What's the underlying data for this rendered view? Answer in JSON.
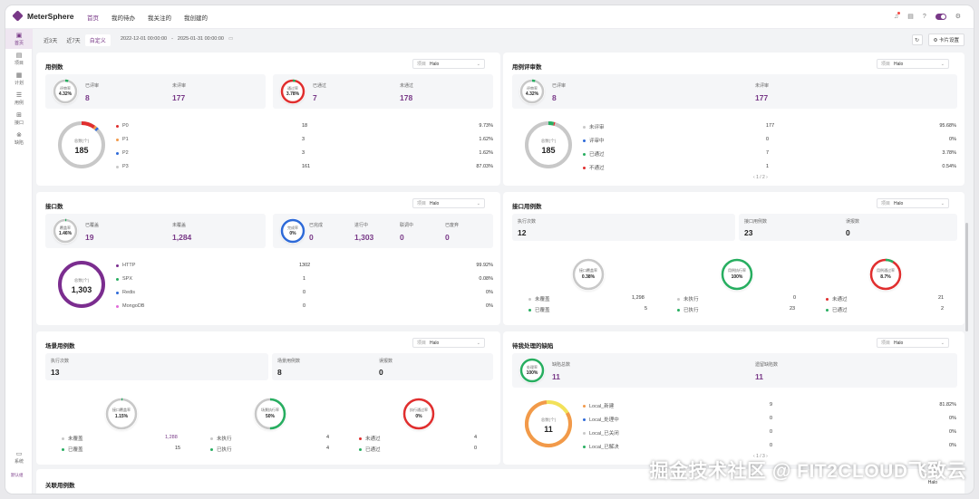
{
  "app": {
    "name": "MeterSphere"
  },
  "top_nav": [
    "首页",
    "我的待办",
    "我关注的",
    "我创建的"
  ],
  "sidebar": {
    "items": [
      {
        "label": "首页",
        "icon": "home-icon",
        "glyph": "▣"
      },
      {
        "label": "项目",
        "icon": "project-icon",
        "glyph": "▤"
      },
      {
        "label": "计划",
        "icon": "plan-icon",
        "glyph": "▦"
      },
      {
        "label": "用例",
        "icon": "case-icon",
        "glyph": "☰"
      },
      {
        "label": "接口",
        "icon": "api-icon",
        "glyph": "⊞"
      },
      {
        "label": "缺陷",
        "icon": "bug-icon",
        "glyph": "⊗"
      }
    ],
    "bottom": {
      "label": "系统",
      "glyph": "▭"
    },
    "org": "默认组"
  },
  "filter": {
    "options": [
      "近3天",
      "近7天",
      "自定义"
    ],
    "selected": "自定义",
    "start": "2022-12-01 00:00:00",
    "separator": "-",
    "end": "2025-01-31 00:00:00",
    "card_settings": "卡片设置"
  },
  "project_select": {
    "label": "项目",
    "value": "Halo"
  },
  "cards": {
    "case_count": {
      "title": "用例数",
      "ring": {
        "title": "评审率",
        "value": "4.32%",
        "color": "#b5b5b5"
      },
      "reviewed": {
        "label": "已评审",
        "value": "8"
      },
      "unreviewed": {
        "label": "未评审",
        "value": "177"
      },
      "ring2": {
        "title": "通过率",
        "value": "3.78%",
        "color": "#e02e2e"
      },
      "passed": {
        "label": "已通过",
        "value": "7"
      },
      "notpassed": {
        "label": "未通过",
        "value": "178"
      },
      "donut": {
        "title": "总数(个)",
        "value": "185"
      },
      "legend": [
        {
          "name": "P0",
          "count": "18",
          "pct": "9.73%",
          "color": "#e02e2e"
        },
        {
          "name": "P1",
          "count": "3",
          "pct": "1.62%",
          "color": "#f2994a"
        },
        {
          "name": "P2",
          "count": "3",
          "pct": "1.62%",
          "color": "#2e6ad8"
        },
        {
          "name": "P3",
          "count": "161",
          "pct": "87.03%",
          "color": "#c8c8c8"
        }
      ]
    },
    "case_review": {
      "title": "用例评审数",
      "ring": {
        "title": "评审率",
        "value": "4.32%"
      },
      "reviewed": {
        "label": "已评审",
        "value": "8"
      },
      "unreviewed": {
        "label": "未评审",
        "value": "177"
      },
      "donut": {
        "title": "总数(个)",
        "value": "185"
      },
      "legend": [
        {
          "name": "未评审",
          "count": "177",
          "pct": "95.68%",
          "color": "#c8c8c8"
        },
        {
          "name": "评审中",
          "count": "0",
          "pct": "0%",
          "color": "#2e6ad8"
        },
        {
          "name": "已通过",
          "count": "7",
          "pct": "3.78%",
          "color": "#27ae60"
        },
        {
          "name": "不通过",
          "count": "1",
          "pct": "0.54%",
          "color": "#e02e2e"
        }
      ],
      "pager": "1 / 2"
    },
    "api_count": {
      "title": "接口数",
      "ring": {
        "title": "覆盖率",
        "value": "1.46%"
      },
      "covered": {
        "label": "已覆盖",
        "value": "19"
      },
      "uncovered": {
        "label": "未覆盖",
        "value": "1,284"
      },
      "ring2": {
        "title": "完成率",
        "value": "0%"
      },
      "stats": [
        {
          "label": "已完成",
          "value": "0"
        },
        {
          "label": "进行中",
          "value": "1,303"
        },
        {
          "label": "联调中",
          "value": "0"
        },
        {
          "label": "已废弃",
          "value": "0"
        }
      ],
      "donut": {
        "title": "总数(个)",
        "value": "1,303"
      },
      "legend": [
        {
          "name": "HTTP",
          "count": "1302",
          "pct": "99.92%",
          "color": "#7b2d8f"
        },
        {
          "name": "SPX",
          "count": "1",
          "pct": "0.08%",
          "color": "#27ae60"
        },
        {
          "name": "Redis",
          "count": "0",
          "pct": "0%",
          "color": "#2e6ad8"
        },
        {
          "name": "MongoDB",
          "count": "0",
          "pct": "0%",
          "color": "#e26bd9"
        }
      ]
    },
    "api_case": {
      "title": "接口用例数",
      "stats": [
        {
          "label": "执行次数",
          "value": "12"
        },
        {
          "label": "接口用例数",
          "value": "23"
        },
        {
          "label": "误报数",
          "value": "0"
        }
      ],
      "rings": [
        {
          "title": "接口覆盖率",
          "value": "0.38%"
        },
        {
          "title": "用例执行率",
          "value": "100%"
        },
        {
          "title": "用例通过率",
          "value": "8.7%"
        }
      ],
      "legends": [
        [
          {
            "name": "未覆盖",
            "v": "1,298"
          },
          {
            "name": "已覆盖",
            "v": "5"
          }
        ],
        [
          {
            "name": "未执行",
            "v": "0"
          },
          {
            "name": "已执行",
            "v": "23"
          }
        ],
        [
          {
            "name": "未通过",
            "v": "21"
          },
          {
            "name": "已通过",
            "v": "2"
          }
        ]
      ]
    },
    "scenario": {
      "title": "场景用例数",
      "stats": [
        {
          "label": "执行次数",
          "value": "13"
        },
        {
          "label": "场景用例数",
          "value": "8"
        },
        {
          "label": "误报数",
          "value": "0"
        }
      ],
      "rings": [
        {
          "title": "接口覆盖率",
          "value": "1.15%"
        },
        {
          "title": "场景执行率",
          "value": "50%"
        },
        {
          "title": "执行通过率",
          "value": "0%"
        }
      ],
      "legends": [
        [
          {
            "name": "未覆盖",
            "v": "1,288"
          },
          {
            "name": "已覆盖",
            "v": "15"
          }
        ],
        [
          {
            "name": "未执行",
            "v": "4"
          },
          {
            "name": "已执行",
            "v": "4"
          }
        ],
        [
          {
            "name": "未通过",
            "v": "4"
          },
          {
            "name": "已通过",
            "v": "0"
          }
        ]
      ]
    },
    "bugs": {
      "title": "待我处理的缺陷",
      "ring": {
        "title": "处理率",
        "value": "100%"
      },
      "total": {
        "label": "缺陷总数",
        "value": "11"
      },
      "legacy": {
        "label": "遗留缺陷数",
        "value": "11"
      },
      "donut": {
        "title": "总数(个)",
        "value": "11"
      },
      "legend": [
        {
          "name": "Local_新建",
          "count": "9",
          "pct": "81.82%",
          "color": "#f2994a"
        },
        {
          "name": "Local_处理中",
          "count": "0",
          "pct": "0%",
          "color": "#2e6ad8"
        },
        {
          "name": "Local_已关闭",
          "count": "0",
          "pct": "0%",
          "color": "#c8c8c8"
        },
        {
          "name": "Local_已解决",
          "count": "0",
          "pct": "0%",
          "color": "#27ae60"
        }
      ],
      "pager": "1 / 3"
    },
    "related": {
      "title": "关联用例数",
      "select_value": "Halo"
    }
  },
  "watermark": "掘金技术社区 @ FIT2CLOUD飞致云"
}
